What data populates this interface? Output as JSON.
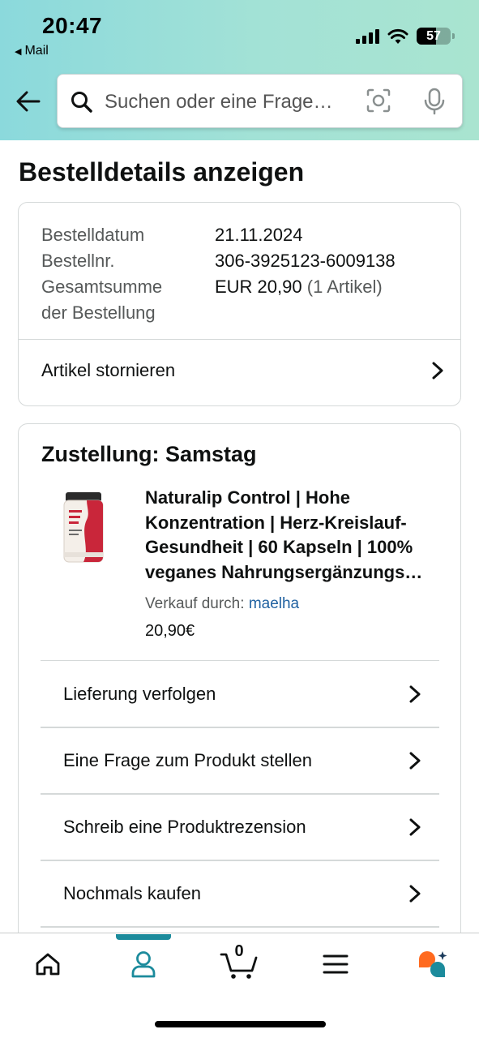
{
  "status_bar": {
    "time": "20:47",
    "back_app": "Mail",
    "battery": "57"
  },
  "search": {
    "placeholder": "Suchen oder eine Frage…"
  },
  "page": {
    "title": "Bestelldetails anzeigen"
  },
  "summary": {
    "order_date_label": "Bestelldatum",
    "order_date_value": "21.11.2024",
    "order_no_label": "Bestellnr.",
    "order_no_value": "306-3925123-6009138",
    "total_label_line1": "Gesamtsumme",
    "total_label_line2": "der Bestellung",
    "total_value": "EUR 20,90",
    "total_count": "(1 Artikel)",
    "cancel_label": "Artikel stornieren"
  },
  "delivery": {
    "heading": "Zustellung: Samstag",
    "product_title": "Naturalip Control | Hohe Konzentration | Herz-Kreislauf-Gesundheit | 60 Kapseln | 100% veganes Nahrungsergänzungs…",
    "seller_prefix": "Verkauf durch:",
    "seller_name": "maelha",
    "price": "20,90€",
    "actions": [
      {
        "label": "Lieferung verfolgen"
      },
      {
        "label": "Eine Frage zum Produkt stellen"
      },
      {
        "label": "Schreib eine Produktrezension"
      },
      {
        "label": "Nochmals kaufen"
      }
    ]
  },
  "tabbar": {
    "cart_count": "0",
    "accent_color": "#1c8b9c",
    "tabs": [
      "home-icon",
      "account-icon",
      "cart-icon",
      "menu-icon",
      "rufus-icon"
    ]
  }
}
